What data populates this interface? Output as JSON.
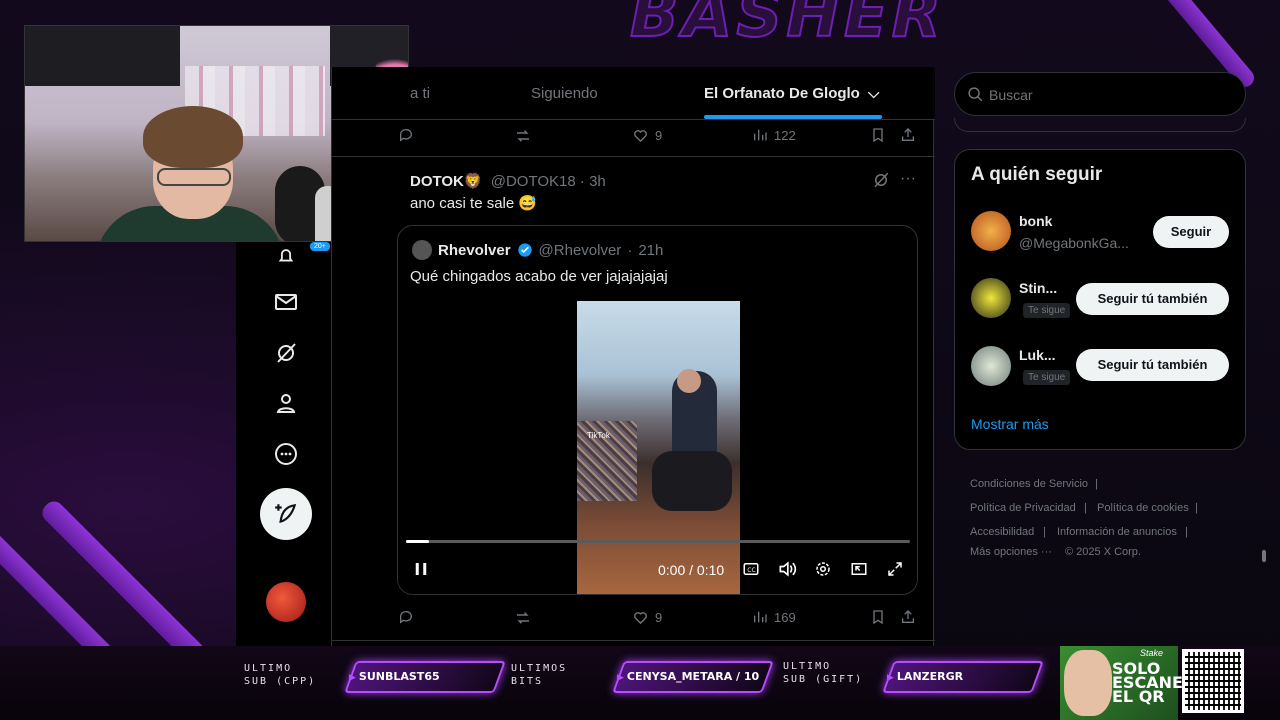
{
  "overlay": {
    "banner_title": "BASHER",
    "subs": [
      {
        "label_line1": "ULTIMO",
        "label_line2": "SUB (CPP)",
        "value": "SUNBLAST65"
      },
      {
        "label_line1": "ULTIMOS",
        "label_line2": "BITS",
        "value": "CENYSA_METARA / 10"
      },
      {
        "label_line1": "ULTIMO",
        "label_line2": "SUB (GIFT)",
        "value": "LANZERGR"
      }
    ],
    "promo_text": "SOLO ESCANEA EL QR",
    "promo_brand": "Stake"
  },
  "leftnav": {
    "badge": "20+",
    "items": [
      "bell-icon",
      "mail-icon",
      "grok-icon",
      "profile-icon",
      "more-icon"
    ]
  },
  "tabs": [
    {
      "label": "Para ti",
      "visible": "a ti",
      "active": false
    },
    {
      "label": "Siguiendo",
      "active": false
    },
    {
      "label": "El Orfanato De Gloglo",
      "active": true
    }
  ],
  "prev_tweet_actions": {
    "likes": "9",
    "views": "122"
  },
  "tweet": {
    "author_name": "DOTOK🦁",
    "author_handle": "@DOTOK18",
    "time": "3h",
    "text": "ano casi te sale 😅",
    "quote": {
      "author_name": "Rhevolver",
      "author_handle": "@Rhevolver",
      "time": "21h",
      "text": "Qué chingados acabo de ver jajajajajaj"
    },
    "video": {
      "current": "0:00",
      "duration": "0:10",
      "time_display": "0:00 / 0:10",
      "progress": 0.045,
      "watermark": "TikTok"
    },
    "actions": {
      "likes": "9",
      "views": "169"
    }
  },
  "search": {
    "placeholder": "Buscar"
  },
  "who_to_follow": {
    "title": "A quién seguir",
    "users": [
      {
        "name": "bonk",
        "handle": "@MegabonkGa...",
        "button": "Seguir",
        "tag": ""
      },
      {
        "name": "Stin...",
        "handle": "",
        "button": "Seguir tú también",
        "tag": "Te sigue"
      },
      {
        "name": "Luk...",
        "handle": "",
        "button": "Seguir tú también",
        "tag": "Te sigue"
      }
    ],
    "show_more": "Mostrar más"
  },
  "footer": {
    "terms": "Condiciones de Servicio",
    "privacy": "Política de Privacidad",
    "cookies": "Política de cookies",
    "accessibility": "Accesibilidad",
    "ads_info": "Información de anuncios",
    "more": "Más opciones ···",
    "copyright": "© 2025 X Corp."
  },
  "colors": {
    "accent": "#1d9bf0",
    "overlay_purple": "#b84dff",
    "background": "#000000"
  }
}
